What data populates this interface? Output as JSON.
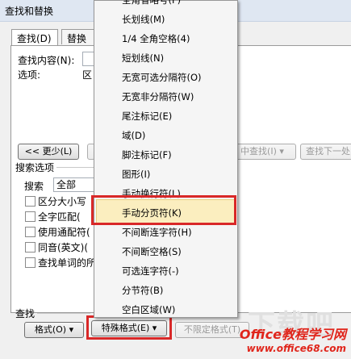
{
  "dialog": {
    "title": "查找和替换",
    "tabs": [
      {
        "label": "查找(D)"
      },
      {
        "label": "替换"
      }
    ],
    "find_label": "查找内容(N):",
    "options_label": "选项:",
    "options_value_prefix": "区",
    "less_button": "<< 更少(L)",
    "find_in_button": "中查找(I) ▾",
    "find_next_button": "查找下一处",
    "search_options_title": "搜索选项",
    "search_label": "搜索",
    "search_value": "全部",
    "checkboxes": [
      {
        "label": "区分大小写"
      },
      {
        "label": "全字匹配("
      },
      {
        "label": "使用通配符("
      },
      {
        "label": "同音(英文)("
      },
      {
        "label": "查找单词的所"
      }
    ],
    "find_section_title": "查找",
    "format_button": "格式(O) ▾",
    "special_button": "特殊格式(E) ▾",
    "no_format_button": "不限定格式(T)"
  },
  "menu": {
    "items": [
      {
        "label": "全角省略号(F)"
      },
      {
        "label": "长划线(M)"
      },
      {
        "label": "1/4 全角空格(4)"
      },
      {
        "label": "短划线(N)"
      },
      {
        "label": "无宽可选分隔符(O)"
      },
      {
        "label": "无宽非分隔符(W)"
      },
      {
        "label": "尾注标记(E)"
      },
      {
        "label": "域(D)"
      },
      {
        "label": "脚注标记(F)"
      },
      {
        "label": "图形(I)"
      },
      {
        "label": "手动换行符(L)"
      },
      {
        "label": "手动分页符(K)"
      },
      {
        "label": "不间断连字符(H)"
      },
      {
        "label": "不间断空格(S)"
      },
      {
        "label": "可选连字符(-)"
      },
      {
        "label": "分节符(B)"
      },
      {
        "label": "空白区域(W)"
      }
    ]
  },
  "watermark": {
    "title": "Office教程学习网",
    "url": "www.office68.com",
    "ghost": "下载吧"
  }
}
